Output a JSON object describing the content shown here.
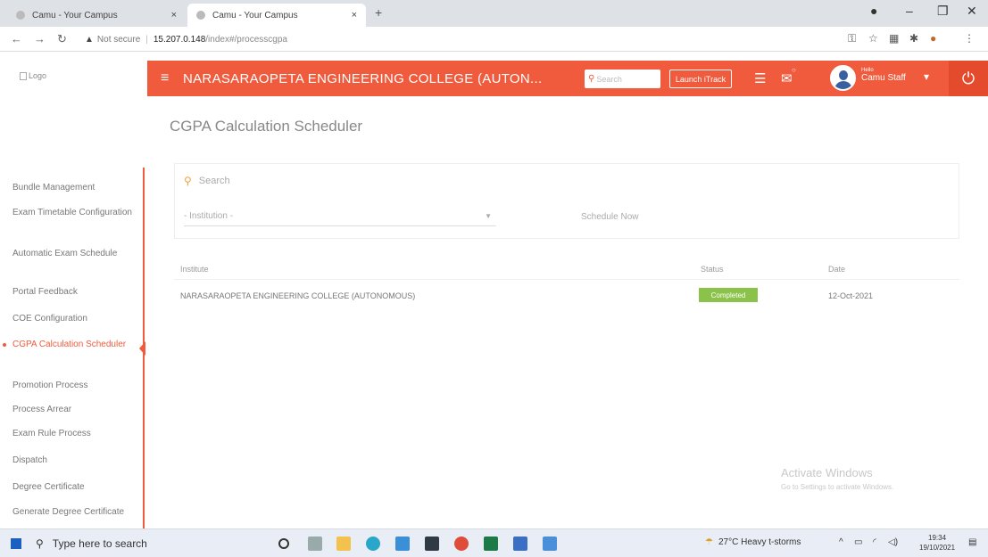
{
  "browser": {
    "tabs": [
      {
        "title": "Camu - Your Campus"
      },
      {
        "title": "Camu - Your Campus"
      }
    ],
    "new_tab_icon": "+",
    "address": {
      "security_label": "Not secure",
      "host": "15.207.0.148",
      "path": "/index#/processcgpa"
    }
  },
  "header": {
    "logo_alt": "Logo",
    "college_name": "NARASARAOPETA ENGINEERING COLLEGE (AUTON...",
    "search_placeholder": "Search",
    "launch_button": "Launch iTrack",
    "user_greeting": "Hello",
    "user_name": "Camu Staff",
    "accent_color": "#ef5b3c"
  },
  "sidebar": {
    "items": [
      {
        "label": "Bundle Management"
      },
      {
        "label": "Exam Timetable Configuration"
      },
      {
        "label": "Automatic Exam Schedule"
      },
      {
        "label": "Portal Feedback"
      },
      {
        "label": "COE Configuration"
      },
      {
        "label": "CGPA Calculation Scheduler",
        "active": true
      },
      {
        "label": "Promotion Process"
      },
      {
        "label": "Process Arrear"
      },
      {
        "label": "Exam Rule Process"
      },
      {
        "label": "Dispatch"
      },
      {
        "label": "Degree Certificate"
      },
      {
        "label": "Generate Degree Certificate"
      }
    ]
  },
  "main": {
    "title": "CGPA Calculation Scheduler",
    "search_label": "Search",
    "institution_placeholder": "- Institution -",
    "schedule_now": "Schedule Now",
    "table": {
      "headers": [
        "Institute",
        "Status",
        "Date"
      ],
      "rows": [
        {
          "institute": "NARASARAOPETA ENGINEERING COLLEGE (AUTONOMOUS)",
          "status": "Completed",
          "date": "12-Oct-2021"
        }
      ]
    },
    "status_color": "#8bc34a"
  },
  "watermark": {
    "line1": "Activate Windows",
    "line2": "Go to Settings to activate Windows."
  },
  "taskbar": {
    "search_placeholder": "Type here to search",
    "weather": "27°C  Heavy t-storms",
    "time": "19:34",
    "date": "19/10/2021"
  }
}
